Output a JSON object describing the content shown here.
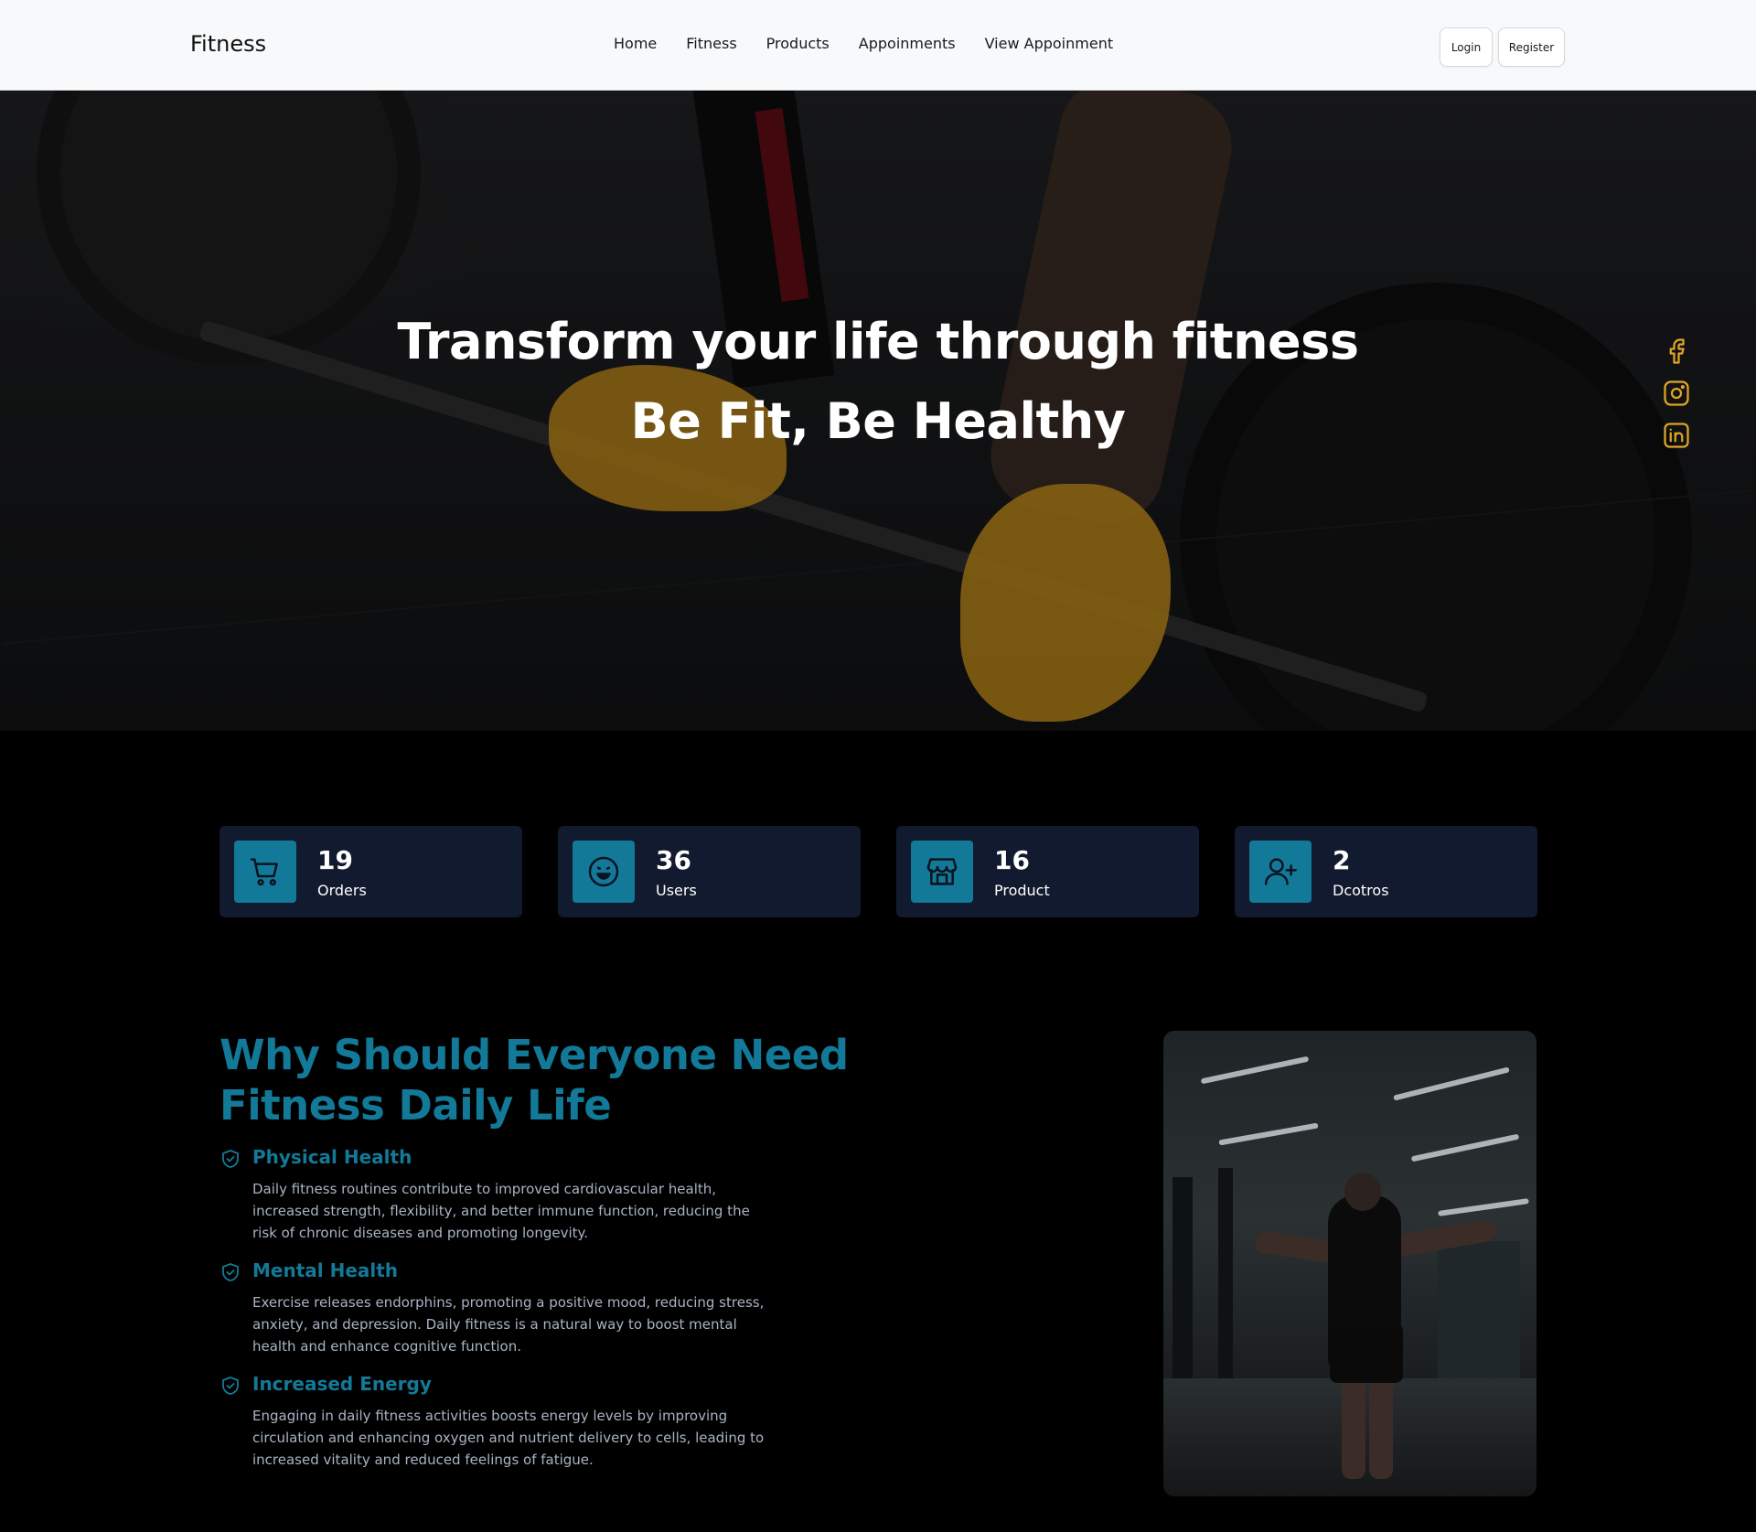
{
  "navbar": {
    "brand": "Fitness",
    "links": [
      "Home",
      "Fitness",
      "Products",
      "Appoinments",
      "View Appoinment"
    ],
    "login_label": "Login",
    "register_label": "Register"
  },
  "hero": {
    "title": "Transform your life through fitness",
    "subtitle": "Be Fit, Be Healthy",
    "social_icons": [
      "facebook-icon",
      "instagram-icon",
      "linkedin-icon"
    ],
    "social_color": "#e0a526"
  },
  "stats": [
    {
      "value": "19",
      "label": "Orders",
      "icon": "cart-icon"
    },
    {
      "value": "36",
      "label": "Users",
      "icon": "smile-icon"
    },
    {
      "value": "16",
      "label": "Product",
      "icon": "store-icon"
    },
    {
      "value": "2",
      "label": "Dcotros",
      "icon": "user-plus-icon"
    }
  ],
  "why": {
    "title": "Why Should Everyone Need Fitness Daily Life",
    "features": [
      {
        "title": "Physical Health",
        "description": "Daily fitness routines contribute to improved cardiovascular health, increased strength, flexibility, and better immune function, reducing the risk of chronic diseases and promoting longevity."
      },
      {
        "title": "Mental Health",
        "description": "Exercise releases endorphins, promoting a positive mood, reducing stress, anxiety, and depression. Daily fitness is a natural way to boost mental health and enhance cognitive function."
      },
      {
        "title": "Increased Energy",
        "description": "Engaging in daily fitness activities boosts energy levels by improving circulation and enhancing oxygen and nutrient delivery to cells, leading to increased vitality and reduced feelings of fatigue."
      }
    ]
  },
  "colors": {
    "accent": "#127a98",
    "card_bg": "#111a2e",
    "page_bg": "#000000",
    "navbar_bg": "#f8f9fb"
  }
}
